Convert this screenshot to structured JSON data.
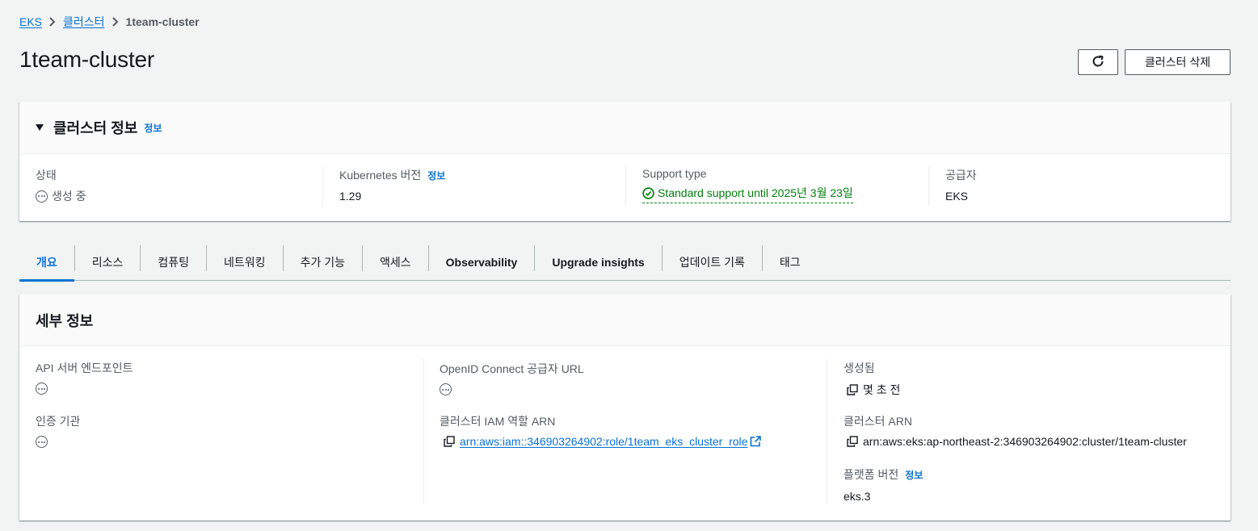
{
  "breadcrumb": {
    "items": [
      "EKS",
      "클러스터"
    ],
    "current": "1team-cluster"
  },
  "page": {
    "title": "1team-cluster",
    "delete_button": "클러스터 삭제"
  },
  "cluster_info": {
    "title": "클러스터 정보",
    "info_link": "정보",
    "status_label": "상태",
    "status_value": "생성 중",
    "k8s_label": "Kubernetes 버전",
    "k8s_info_link": "정보",
    "k8s_value": "1.29",
    "support_label": "Support type",
    "support_value": "Standard support until 2025년 3월 23일",
    "provider_label": "공급자",
    "provider_value": "EKS"
  },
  "tabs": [
    {
      "label": "개요",
      "active": true
    },
    {
      "label": "리소스"
    },
    {
      "label": "컴퓨팅"
    },
    {
      "label": "네트워킹"
    },
    {
      "label": "추가 기능"
    },
    {
      "label": "액세스"
    },
    {
      "label": "Observability"
    },
    {
      "label": "Upgrade insights"
    },
    {
      "label": "업데이트 기록"
    },
    {
      "label": "태그"
    }
  ],
  "details": {
    "title": "세부 정보",
    "api_endpoint_label": "API 서버 엔드포인트",
    "cert_authority_label": "인증 기관",
    "oidc_label": "OpenID Connect 공급자 URL",
    "iam_role_label": "클러스터 IAM 역할 ARN",
    "iam_role_value": "arn:aws:iam::346903264902:role/1team_eks_cluster_role",
    "created_label": "생성됨",
    "created_value": "몇 초 전",
    "cluster_arn_label": "클러스터 ARN",
    "cluster_arn_value": "arn:aws:eks:ap-northeast-2:346903264902:cluster/1team-cluster",
    "platform_label": "플랫폼 버전",
    "platform_info_link": "정보",
    "platform_value": "eks.3"
  },
  "colors": {
    "link": "#0972d3",
    "success": "#037f0c",
    "text": "#16191f",
    "muted": "#545b64",
    "background": "#f2f3f3"
  }
}
